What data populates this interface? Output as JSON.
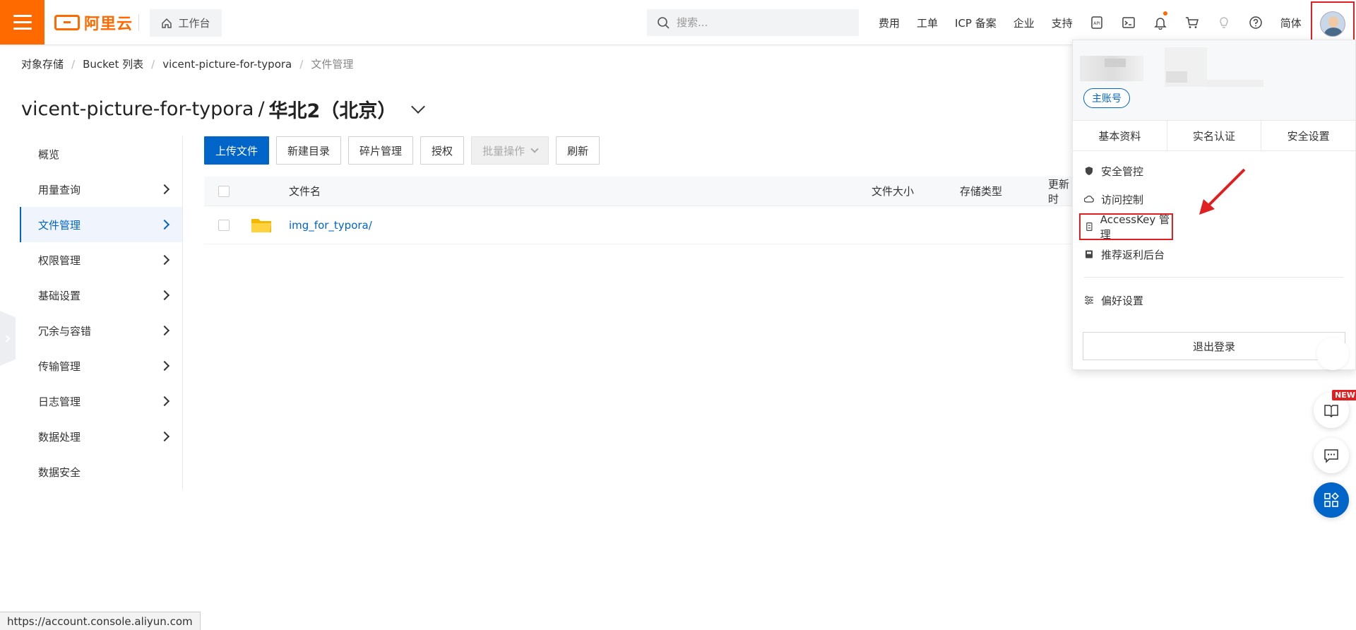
{
  "header": {
    "logo_text": "阿里云",
    "workbench_label": "工作台",
    "search_placeholder": "搜索...",
    "links": [
      "费用",
      "工单",
      "ICP 备案",
      "企业",
      "支持"
    ],
    "lang_label": "简体",
    "accent_color": "#ff6a00"
  },
  "breadcrumb": [
    "对象存储",
    "Bucket 列表",
    "vicent-picture-for-typora",
    "文件管理"
  ],
  "page": {
    "bucket_name": "vicent-picture-for-typora",
    "title_sep": "/",
    "region": "华北2（北京）"
  },
  "sidebar": {
    "items": [
      {
        "label": "概览"
      },
      {
        "label": "用量查询"
      },
      {
        "label": "文件管理"
      },
      {
        "label": "权限管理"
      },
      {
        "label": "基础设置"
      },
      {
        "label": "冗余与容错"
      },
      {
        "label": "传输管理"
      },
      {
        "label": "日志管理"
      },
      {
        "label": "数据处理"
      },
      {
        "label": "数据安全"
      }
    ],
    "active_index": 2,
    "active_color": "#0064c8"
  },
  "toolbar": {
    "upload": "上传文件",
    "new_dir": "新建目录",
    "fragment": "碎片管理",
    "authorize": "授权",
    "batch": "批量操作",
    "refresh": "刷新"
  },
  "table": {
    "headers": {
      "name": "文件名",
      "size": "文件大小",
      "storage_type": "存储类型",
      "updated": "更新时"
    },
    "rows": [
      {
        "name": "img_for_typora/"
      }
    ]
  },
  "account_menu": {
    "badge": "主账号",
    "tabs": [
      "基本资料",
      "实名认证",
      "安全设置"
    ],
    "items": {
      "security": "安全管控",
      "access": "访问控制",
      "accesskey": "AccessKey 管理",
      "referral": "推荐返利后台",
      "preferences": "偏好设置"
    },
    "logout": "退出登录"
  },
  "floating": {
    "new_tag": "NEW"
  },
  "status_url": "https://account.console.aliyun.com"
}
